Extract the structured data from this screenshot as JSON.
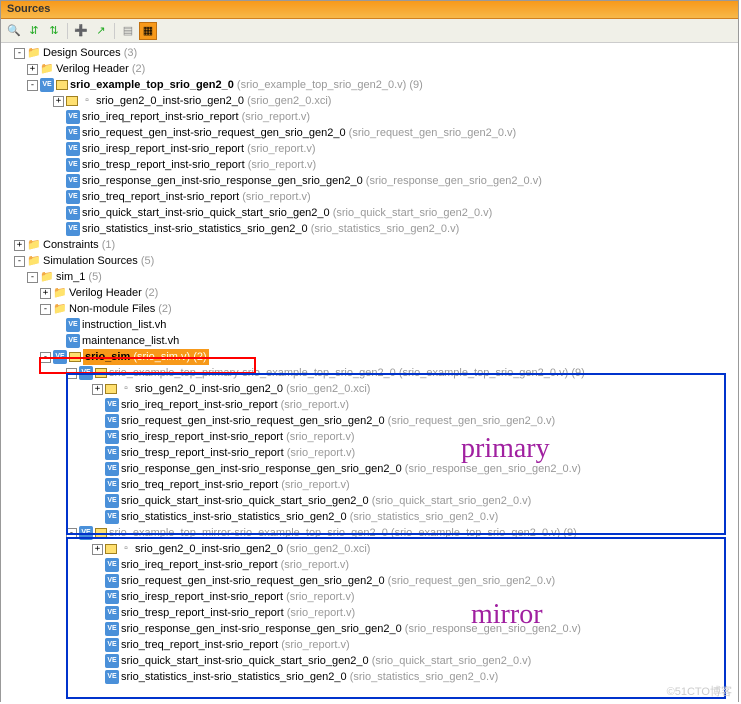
{
  "window": {
    "title": "Sources"
  },
  "tree": {
    "design_sources": {
      "label": "Design Sources",
      "count": "(3)"
    },
    "verilog_header": {
      "label": "Verilog Header",
      "count": "(2)"
    },
    "example_top": {
      "name": "srio_example_top_srio_gen2_0",
      "file": "(srio_example_top_srio_gen2_0.v)",
      "count": "(9)"
    },
    "inst_gen2": {
      "name": "srio_gen2_0_inst",
      "mod": "srio_gen2_0",
      "file": "(srio_gen2_0.xci)"
    },
    "inst_ireq": {
      "name": "srio_ireq_report_inst",
      "mod": "srio_report",
      "file": "(srio_report.v)"
    },
    "inst_req": {
      "name": "srio_request_gen_inst",
      "mod": "srio_request_gen_srio_gen2_0",
      "file": "(srio_request_gen_srio_gen2_0.v)"
    },
    "inst_iresp": {
      "name": "srio_iresp_report_inst",
      "mod": "srio_report",
      "file": "(srio_report.v)"
    },
    "inst_tresp": {
      "name": "srio_tresp_report_inst",
      "mod": "srio_report",
      "file": "(srio_report.v)"
    },
    "inst_resp": {
      "name": "srio_response_gen_inst",
      "mod": "srio_response_gen_srio_gen2_0",
      "file": "(srio_response_gen_srio_gen2_0.v)"
    },
    "inst_treq": {
      "name": "srio_treq_report_inst",
      "mod": "srio_report",
      "file": "(srio_report.v)"
    },
    "inst_qs": {
      "name": "srio_quick_start_inst",
      "mod": "srio_quick_start_srio_gen2_0",
      "file": "(srio_quick_start_srio_gen2_0.v)"
    },
    "inst_stats": {
      "name": "srio_statistics_inst",
      "mod": "srio_statistics_srio_gen2_0",
      "file": "(srio_statistics_srio_gen2_0.v)"
    },
    "constraints": {
      "label": "Constraints",
      "count": "(1)"
    },
    "sim_sources": {
      "label": "Simulation Sources",
      "count": "(5)"
    },
    "sim_1": {
      "label": "sim_1",
      "count": "(5)"
    },
    "nonmod": {
      "label": "Non-module Files",
      "count": "(2)"
    },
    "instr_list": {
      "label": "instruction_list.vh"
    },
    "maint_list": {
      "label": "maintenance_list.vh"
    },
    "srio_sim": {
      "name": "srio_sim",
      "file": "(srio_sim.v)",
      "count": "(2)"
    },
    "top_primary": {
      "name": "srio_example_top_primary",
      "mod": "srio_example_top_srio_gen2_0",
      "file": "(srio_example_top_srio_gen2_0.v)",
      "count": "(9)"
    },
    "top_mirror": {
      "name": "srio_example_top_mirror",
      "mod": "srio_example_top_srio_gen2_0",
      "file": "(srio_example_top_srio_gen2_0.v)",
      "count": "(9)"
    }
  },
  "sep": " - ",
  "anno": {
    "primary": "primary",
    "mirror": "mirror"
  },
  "watermark": "©51CTO博客"
}
